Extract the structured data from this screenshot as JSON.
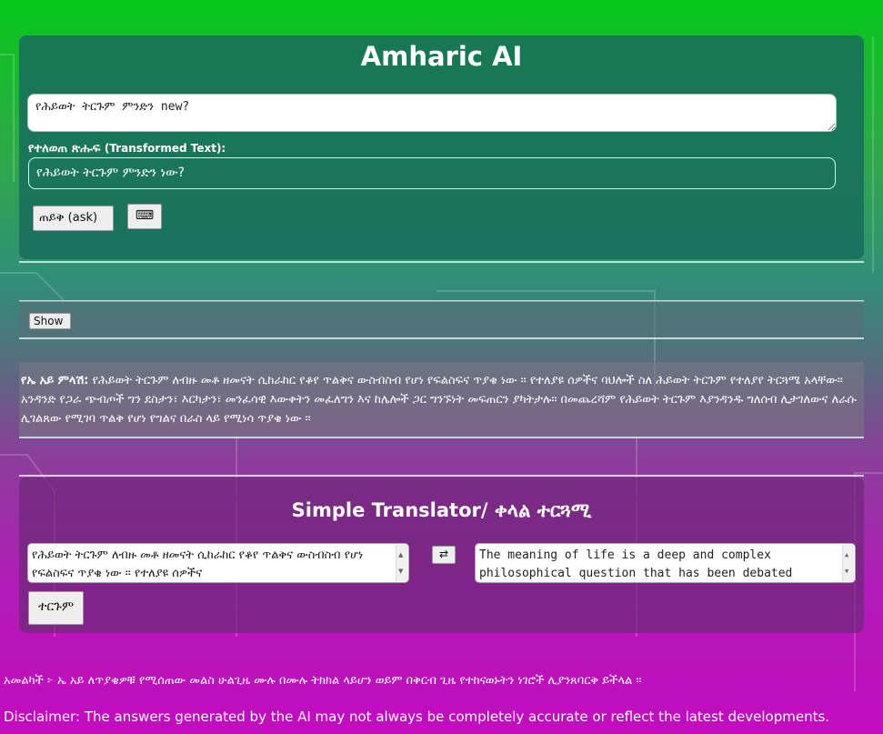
{
  "app": {
    "title": "Amharic AI",
    "question_input": "የሕይወት ትርጉም ምንድን new?",
    "transformed_label": "የተለወጠ ጽሑፍ",
    "transformed_label_sub": "(Transformed Text):",
    "transformed_text": "የሕይወት ትርጉም ምንድን ነው?",
    "ask_button": "ጠይቅ (ask)",
    "keyboard_button": "⌨"
  },
  "show_button": "Show",
  "answer": {
    "label": "የኤ አይ ምላሽ:",
    "text": "የሕይወት ትርጉም ለብዙ መቶ ዘመናት ሲከራከር የቆየ ጥልቅና ውስብስብ የሆነ የፍልስፍና ጥያቄ ነው ። የተለያዩ ሰዎችና ባህሎች ስለ ሕይወት ትርጉም የተለያየ ትርጓሜ አላቸው። አንዳንድ የጋራ ጭብጦች ግን ደስታን፣ እርካታን፣ መንፈሳዊ እውቀትን መፈለግን እና ከሌሎች ጋር ግንኙነት መፍጠርን ያካትታሉ። በመጨረሻም የሕይወት ትርጉም እያንዳንዱ ግለሰብ ሊታገለውና ለራሱ ሊገልጸው የሚገባ ጥልቅ የሆነ የግልና በራስ ላይ የሚነሳ ጥያቄ ነው ።"
  },
  "translator": {
    "title": "Simple Translator/ ቀላል ተርጓሚ",
    "source_text": "የሕይወት ትርጉም ለብዙ መቶ ዘመናት ሲከራከር የቆየ ጥልቅና ውስብስብ የሆነ የፍልስፍና ጥያቄ ነው ። የተለያዩ ሰዎችና",
    "swap_button": "⇄",
    "target_text": "The meaning of life is a deep and complex philosophical question that has been debated",
    "translate_button": "ተርጉም"
  },
  "footer": {
    "disclaimer_am": "አመልካች ፦ ኤ አይ ለጥያቄዎቹ የሚሰጠው መልስ ሁልጊዜ ሙሉ በሙሉ ትክክል ላይሆን ወይም በቅርብ ጊዜ የተከናወኑትን ነገሮች ሊያንጸባርቅ ይችላል ።",
    "disclaimer_en": "Disclaimer: The answers generated by the AI may not always be completely accurate or reflect the latest developments."
  }
}
